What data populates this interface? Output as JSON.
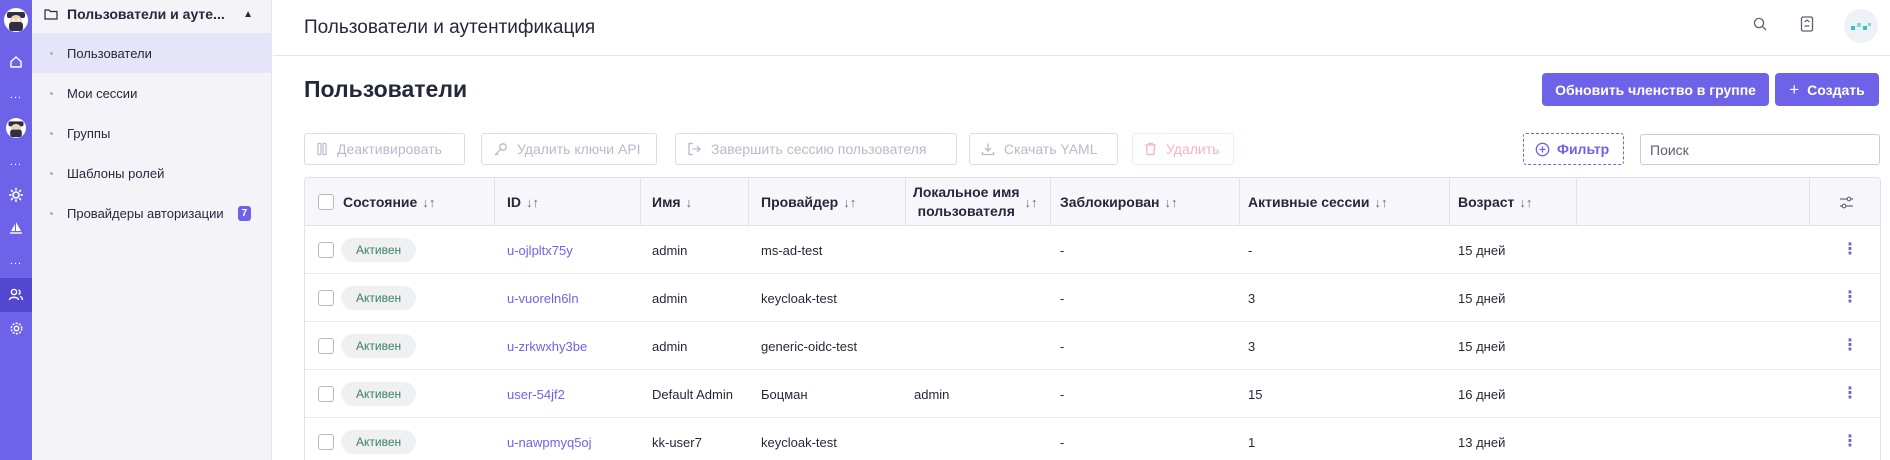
{
  "header": {
    "title": "Пользователи и аутентификация"
  },
  "sidebar": {
    "section_title": "Пользователи и ауте...",
    "items": [
      {
        "label": "Пользователи",
        "selected": true
      },
      {
        "label": "Мои сессии"
      },
      {
        "label": "Группы"
      },
      {
        "label": "Шаблоны ролей"
      },
      {
        "label": "Провайдеры авторизации",
        "badge": "7"
      }
    ]
  },
  "rail": {
    "dots": "..."
  },
  "page": {
    "title": "Пользователи",
    "update_membership_label": "Обновить членство в группе",
    "create_label": "Создать"
  },
  "toolbar": {
    "deactivate_label": "Деактивировать",
    "delete_api_keys_label": "Удалить ключи API",
    "end_session_label": "Завершить сессию пользователя",
    "download_yaml_label": "Скачать YAML",
    "delete_label": "Удалить",
    "filter_label": "Фильтр",
    "search_placeholder": "Поиск"
  },
  "table": {
    "columns": [
      "Состояние",
      "ID",
      "Имя",
      "Провайдер",
      "Локальное имя пользователя",
      "Заблокирован",
      "Активные сессии",
      "Возраст"
    ],
    "local_name_line1": "Локальное имя",
    "local_name_line2": "пользователя",
    "rows": [
      {
        "status": "Активен",
        "id": "u-ojlpltx75y",
        "name": "admin",
        "provider": "ms-ad-test",
        "local_name": "",
        "blocked": "-",
        "sessions": "-",
        "age": "15 дней"
      },
      {
        "status": "Активен",
        "id": "u-vuoreln6ln",
        "name": "admin",
        "provider": "keycloak-test",
        "local_name": "",
        "blocked": "-",
        "sessions": "3",
        "age": "15 дней"
      },
      {
        "status": "Активен",
        "id": "u-zrkwxhy3be",
        "name": "admin",
        "provider": "generic-oidc-test",
        "local_name": "",
        "blocked": "-",
        "sessions": "3",
        "age": "15 дней"
      },
      {
        "status": "Активен",
        "id": "user-54jf2",
        "name": "Default Admin",
        "provider": "Боцман",
        "local_name": "admin",
        "blocked": "-",
        "sessions": "15",
        "age": "16 дней"
      },
      {
        "status": "Активен",
        "id": "u-nawpmyq5oj",
        "name": "kk-user7",
        "provider": "keycloak-test",
        "local_name": "",
        "blocked": "-",
        "sessions": "1",
        "age": "13 дней"
      }
    ]
  },
  "icons": {
    "rail": [
      "logo-avatar-icon",
      "home-icon",
      "avatar-icon",
      "gear-cluster-icon",
      "sail-icon",
      "users-icon",
      "settings-icon"
    ],
    "top": [
      "search-icon",
      "document-icon",
      "user-avatar-icon"
    ]
  },
  "colors": {
    "accent": "#6e63e8",
    "rail_active": "#5447cf",
    "status_text": "#3d7d64",
    "danger_faded": "#f4b3bd"
  }
}
